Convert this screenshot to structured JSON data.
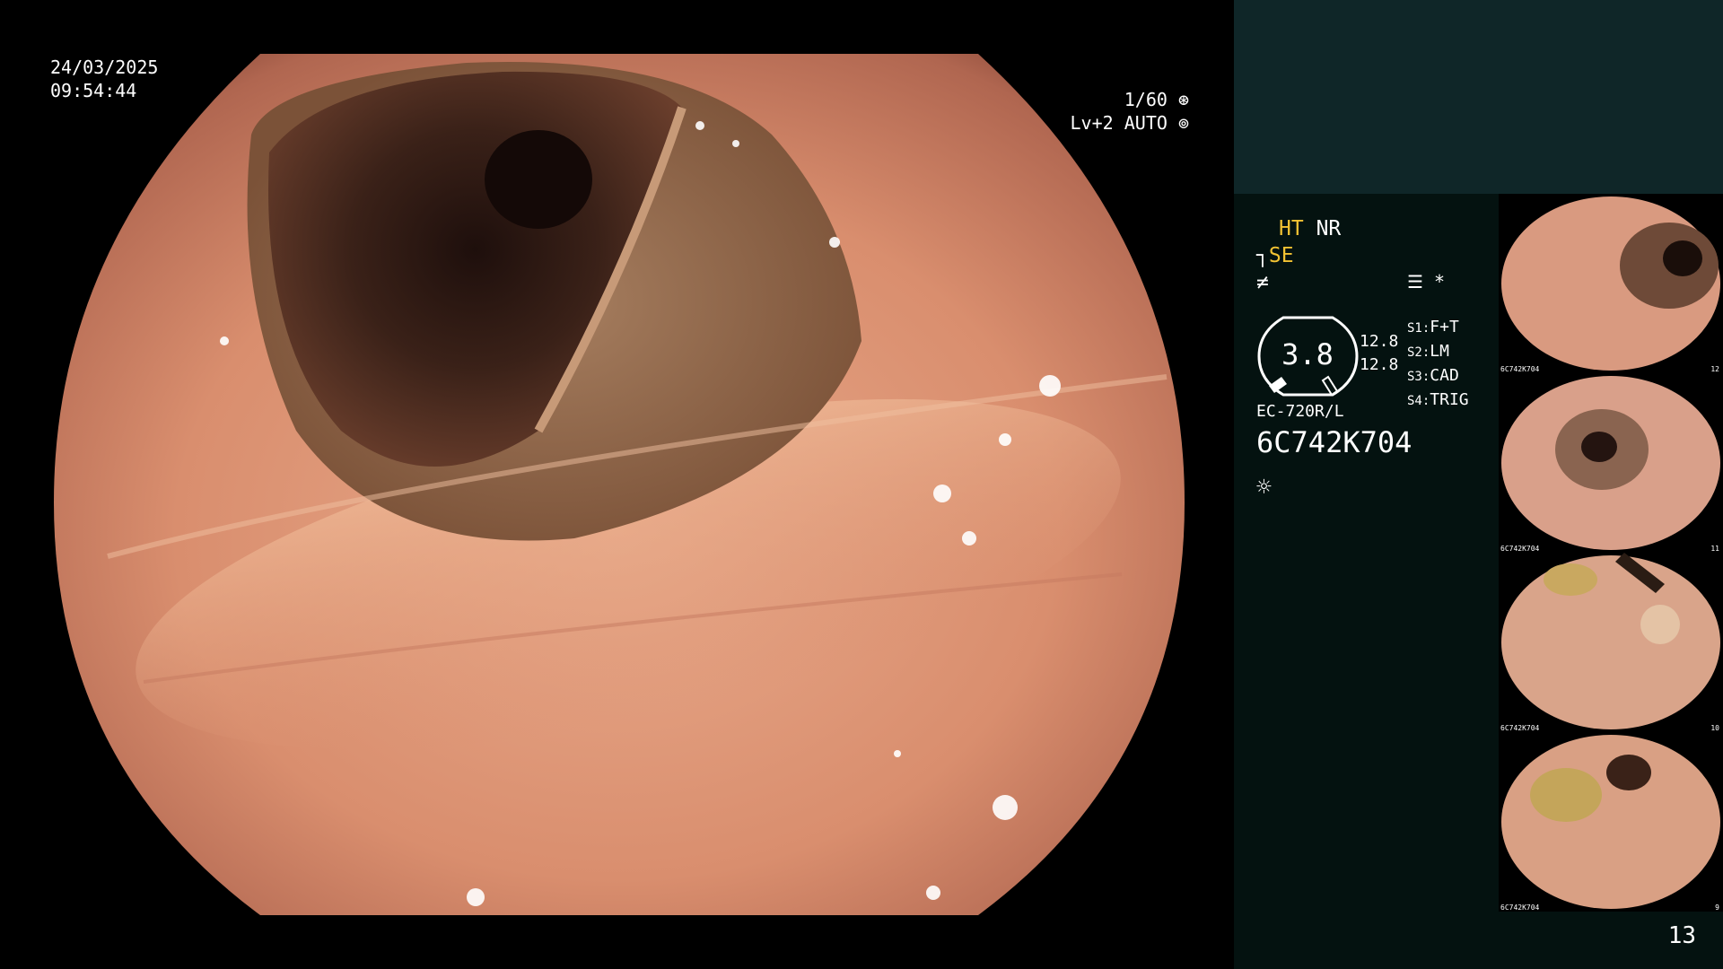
{
  "osd": {
    "date": "24/03/2025",
    "time": "09:54:44",
    "shutter": "1/60",
    "level": "Lv+2",
    "iris": "AUTO"
  },
  "panel": {
    "ht": "HT",
    "nr": "NR",
    "se": "SE",
    "gauge_value": "3.8",
    "values": [
      "12.8",
      "12.8"
    ],
    "switches": [
      {
        "key": "S1:",
        "value": "F+T"
      },
      {
        "key": "S2:",
        "value": "LM"
      },
      {
        "key": "S3:",
        "value": "CAD"
      },
      {
        "key": "S4:",
        "value": "TRIG"
      }
    ],
    "scope_model": "EC-720R/L",
    "scope_serial": "6C742K704",
    "asterisk": "*"
  },
  "thumbnails": [
    {
      "caption": "6C742K704",
      "index": "12"
    },
    {
      "caption": "6C742K704",
      "index": "11"
    },
    {
      "caption": "6C742K704",
      "index": "10"
    },
    {
      "caption": "6C742K704",
      "index": "9"
    }
  ],
  "page_number": "13",
  "colors": {
    "accent": "#f2c233",
    "panel_top": "#0f2628",
    "panel_bg": "#041210"
  }
}
